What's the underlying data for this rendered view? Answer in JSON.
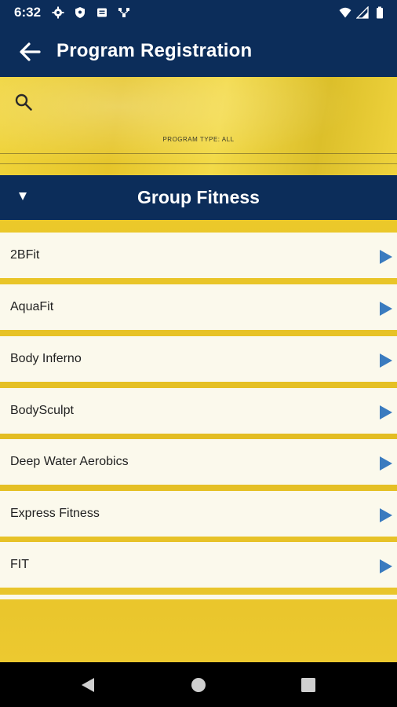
{
  "status_bar": {
    "time": "6:32",
    "left_icons": [
      "gear-icon",
      "shield-icon",
      "message-icon",
      "network-icon"
    ],
    "right_icons": [
      "wifi-icon",
      "signal-icon",
      "battery-icon"
    ]
  },
  "header": {
    "title": "Program Registration",
    "back_icon": "arrow-left-icon"
  },
  "filter": {
    "search_icon": "search-icon",
    "program_type_label": "PROGRAM TYPE: ALL"
  },
  "section": {
    "title": "Group Fitness",
    "toggle_icon": "triangle-down-icon"
  },
  "programs": [
    {
      "name": "2BFit"
    },
    {
      "name": "AquaFit"
    },
    {
      "name": "Body Inferno"
    },
    {
      "name": "BodySculpt"
    },
    {
      "name": "Deep Water Aerobics"
    },
    {
      "name": "Express Fitness"
    },
    {
      "name": "FIT"
    }
  ],
  "colors": {
    "navy": "#0c2d5a",
    "gold": "#e6c52a",
    "arrow_blue": "#3a7bbf",
    "row_background": "#fbf9ec"
  },
  "nav_bar": {
    "buttons": [
      "back-triangle-icon",
      "home-circle-icon",
      "recents-square-icon"
    ]
  }
}
